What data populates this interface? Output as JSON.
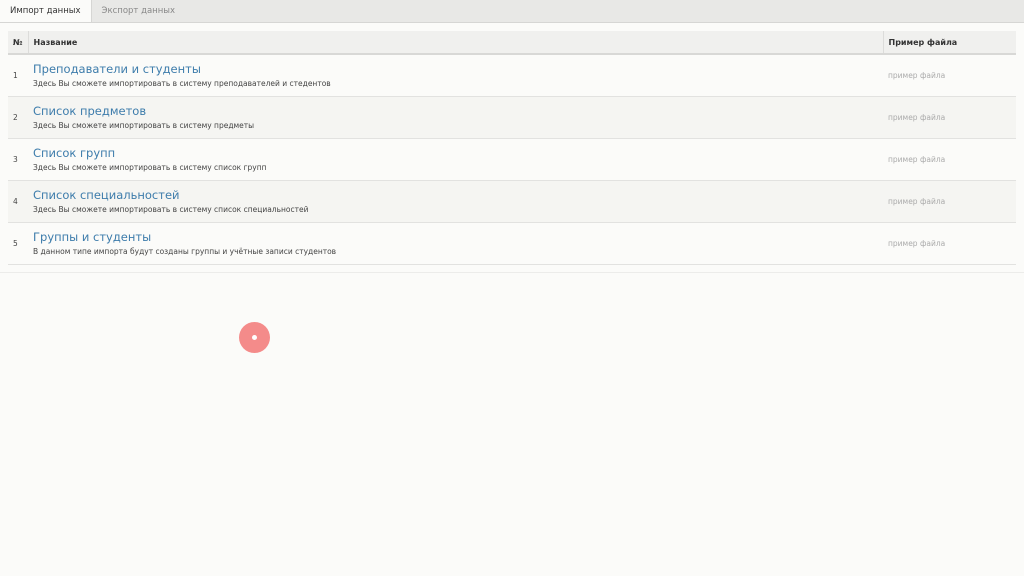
{
  "tabs": [
    {
      "label": "Импорт данных",
      "active": true
    },
    {
      "label": "Экспорт данных",
      "active": false
    }
  ],
  "table": {
    "headers": {
      "num": "№",
      "name": "Название",
      "sample": "Пример файла"
    },
    "rows": [
      {
        "num": "1",
        "title": "Преподаватели и студенты",
        "description": "Здесь Вы сможете импортировать в систему преподавателей и стедентов",
        "sample": "пример файла"
      },
      {
        "num": "2",
        "title": "Список предметов",
        "description": "Здесь Вы сможете импортировать в систему предметы",
        "sample": "пример файла"
      },
      {
        "num": "3",
        "title": "Список групп",
        "description": "Здесь Вы сможете импортировать в систему список групп",
        "sample": "пример файла"
      },
      {
        "num": "4",
        "title": "Список специальностей",
        "description": "Здесь Вы сможете импортировать в систему список специальностей",
        "sample": "пример файла"
      },
      {
        "num": "5",
        "title": "Группы и студенты",
        "description": "В данном типе импорта будут созданы группы и учётные записи студентов",
        "sample": "пример файла"
      }
    ]
  },
  "colors": {
    "link": "#3d7cab",
    "cursor_indicator": "#f47f7f"
  }
}
